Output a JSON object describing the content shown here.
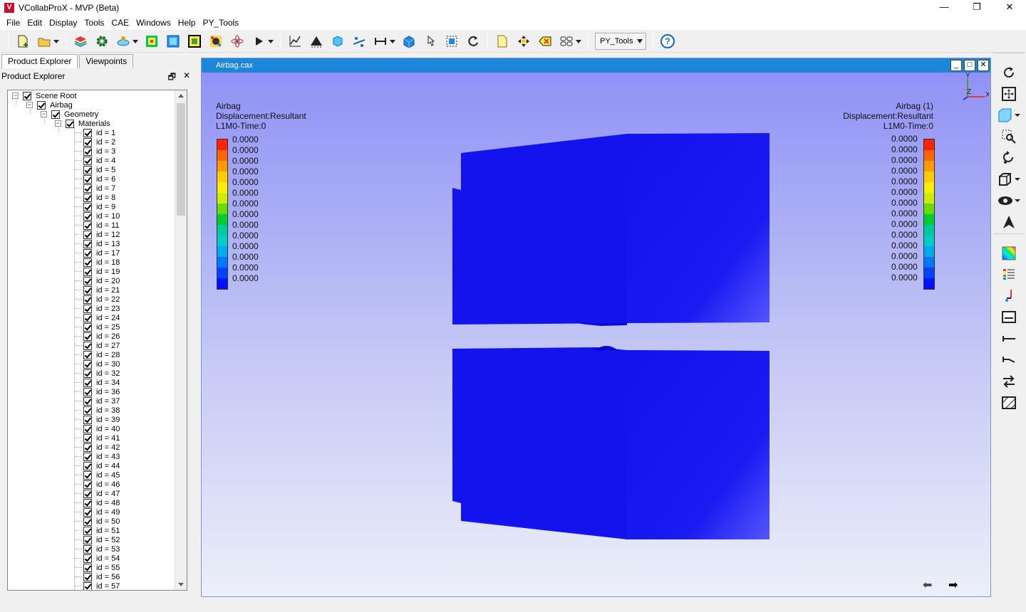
{
  "window": {
    "title": "VCollabProX - MVP (Beta)",
    "logo_letter": "V",
    "min": "—",
    "max": "❐",
    "close": "✕"
  },
  "menu": [
    "File",
    "Edit",
    "Display",
    "Tools",
    "CAE",
    "Windows",
    "Help",
    "PY_Tools"
  ],
  "toolbar": {
    "py_tools_label": "PY_Tools"
  },
  "tabs": [
    "Product Explorer",
    "Viewpoints"
  ],
  "panel": {
    "title": "Product Explorer",
    "float_icon": "🗗",
    "close_icon": "✕"
  },
  "tree": {
    "scene_root": "Scene Root",
    "airbag": "Airbag",
    "geometry": "Geometry",
    "materials": "Materials",
    "ids": [
      "id = 1",
      "id = 2",
      "id = 3",
      "id = 4",
      "id = 5",
      "id = 6",
      "id = 7",
      "id = 8",
      "id = 9",
      "id = 10",
      "id = 11",
      "id = 12",
      "id = 13",
      "id = 17",
      "id = 18",
      "id = 19",
      "id = 20",
      "id = 21",
      "id = 22",
      "id = 23",
      "id = 24",
      "id = 25",
      "id = 26",
      "id = 27",
      "id = 28",
      "id = 30",
      "id = 32",
      "id = 34",
      "id = 36",
      "id = 37",
      "id = 38",
      "id = 39",
      "id = 40",
      "id = 41",
      "id = 42",
      "id = 43",
      "id = 44",
      "id = 45",
      "id = 46",
      "id = 47",
      "id = 48",
      "id = 49",
      "id = 50",
      "id = 51",
      "id = 52",
      "id = 53",
      "id = 54",
      "id = 55",
      "id = 56",
      "id = 57"
    ]
  },
  "viewer": {
    "title": "Airbag.cax",
    "left_legend": {
      "line1": "Airbag",
      "line2": "Displacement:Resultant",
      "line3": "L1M0-Time:0"
    },
    "right_legend": {
      "line1": "Airbag (1)",
      "line2": "Displacement:Resultant",
      "line3": "L1M0-Time:0"
    },
    "legend_values": [
      "0.0000",
      "0.0000",
      "0.0000",
      "0.0000",
      "0.0000",
      "0.0000",
      "0.0000",
      "0.0000",
      "0.0000",
      "0.0000",
      "0.0000",
      "0.0000",
      "0.0000",
      "0.0000"
    ],
    "legend_colors": [
      "#ff2200",
      "#ff6600",
      "#ff9900",
      "#ffcc00",
      "#ffee00",
      "#ccee00",
      "#66dd00",
      "#00cc33",
      "#00cc99",
      "#00cccc",
      "#00aaee",
      "#0077ff",
      "#0044ff",
      "#0011ff"
    ],
    "axes": {
      "x": "X",
      "y": "Y",
      "z": "Z"
    },
    "nav_back": "⬅",
    "nav_fwd": "➡",
    "model_color": "#1414f0"
  }
}
